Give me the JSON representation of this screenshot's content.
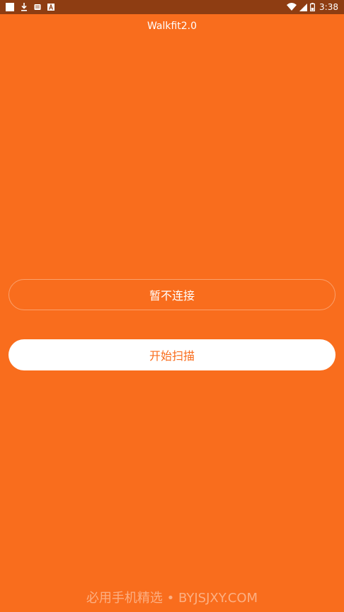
{
  "status_bar": {
    "time": "3:38",
    "left_icons": [
      "notification-square-icon",
      "download-icon",
      "sd-card-icon",
      "a-badge-icon"
    ],
    "right_icons": [
      "wifi-icon",
      "cellular-signal-icon",
      "battery-icon"
    ]
  },
  "app": {
    "title": "Walkfit2.0"
  },
  "buttons": {
    "skip_label": "暂不连接",
    "scan_label": "开始扫描"
  },
  "watermark": "必用手机精选 • BYJSJXY.COM",
  "colors": {
    "background": "#F96D1D",
    "status_bar": "#8E3D12",
    "scan_button_bg": "#FFFFFF",
    "scan_button_text": "#F96D1D"
  }
}
